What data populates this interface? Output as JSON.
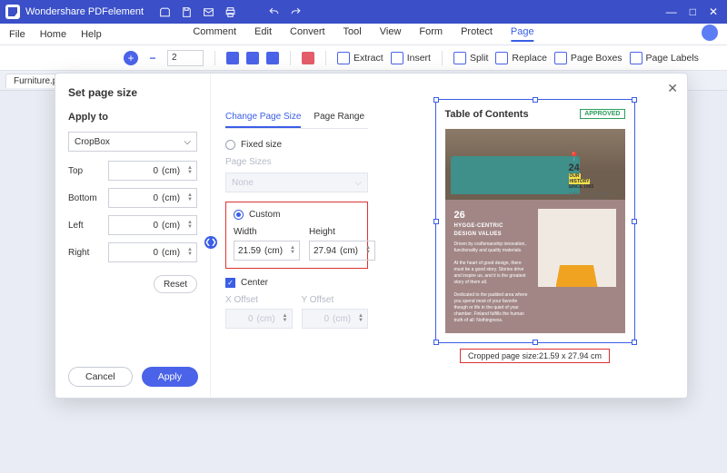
{
  "app": {
    "name": "Wondershare PDFelement"
  },
  "window": {
    "min": "—",
    "max": "□",
    "close": "✕"
  },
  "menus": {
    "left": [
      "File",
      "Home",
      "Help"
    ],
    "center": [
      "Comment",
      "Edit",
      "Convert",
      "Tool",
      "View",
      "Form",
      "Protect",
      "Page"
    ],
    "active": "Page"
  },
  "toolbar": {
    "zoom_minus": "−",
    "zoom_plus": "+",
    "page_current": "2",
    "actions": [
      "Extract",
      "Insert",
      "Split",
      "Replace",
      "Page Boxes",
      "Page Labels"
    ]
  },
  "tabs": {
    "doc": "Furniture.pdf *",
    "close": "×",
    "add": "+"
  },
  "dialog": {
    "title": "Set page size",
    "apply_to": "Apply to",
    "cropbox": "CropBox",
    "sides": {
      "top": "Top",
      "bottom": "Bottom",
      "left": "Left",
      "right": "Right"
    },
    "zero": "0",
    "unit": "(cm)",
    "reset": "Reset",
    "tabs": {
      "change": "Change Page Size",
      "range": "Page Range"
    },
    "fixed": "Fixed size",
    "page_sizes": "Page Sizes",
    "none": "None",
    "custom": "Custom",
    "width": "Width",
    "height": "Height",
    "w_val": "21.59",
    "h_val": "27.94",
    "center": "Center",
    "xoff": "X Offset",
    "yoff": "Y Offset",
    "cancel": "Cancel",
    "apply": "Apply",
    "cropinfo": "Cropped page size:21.59 x 27.94 cm"
  },
  "preview": {
    "toc": "Table of Contents",
    "approved": "APPROVED",
    "n24": "24",
    "our": "OUR",
    "history": "HISTORY",
    "since": "SINCE 1965",
    "n26": "26",
    "hygge": "HYGGE-CENTRIC",
    "design": "DESIGN VALUES"
  }
}
